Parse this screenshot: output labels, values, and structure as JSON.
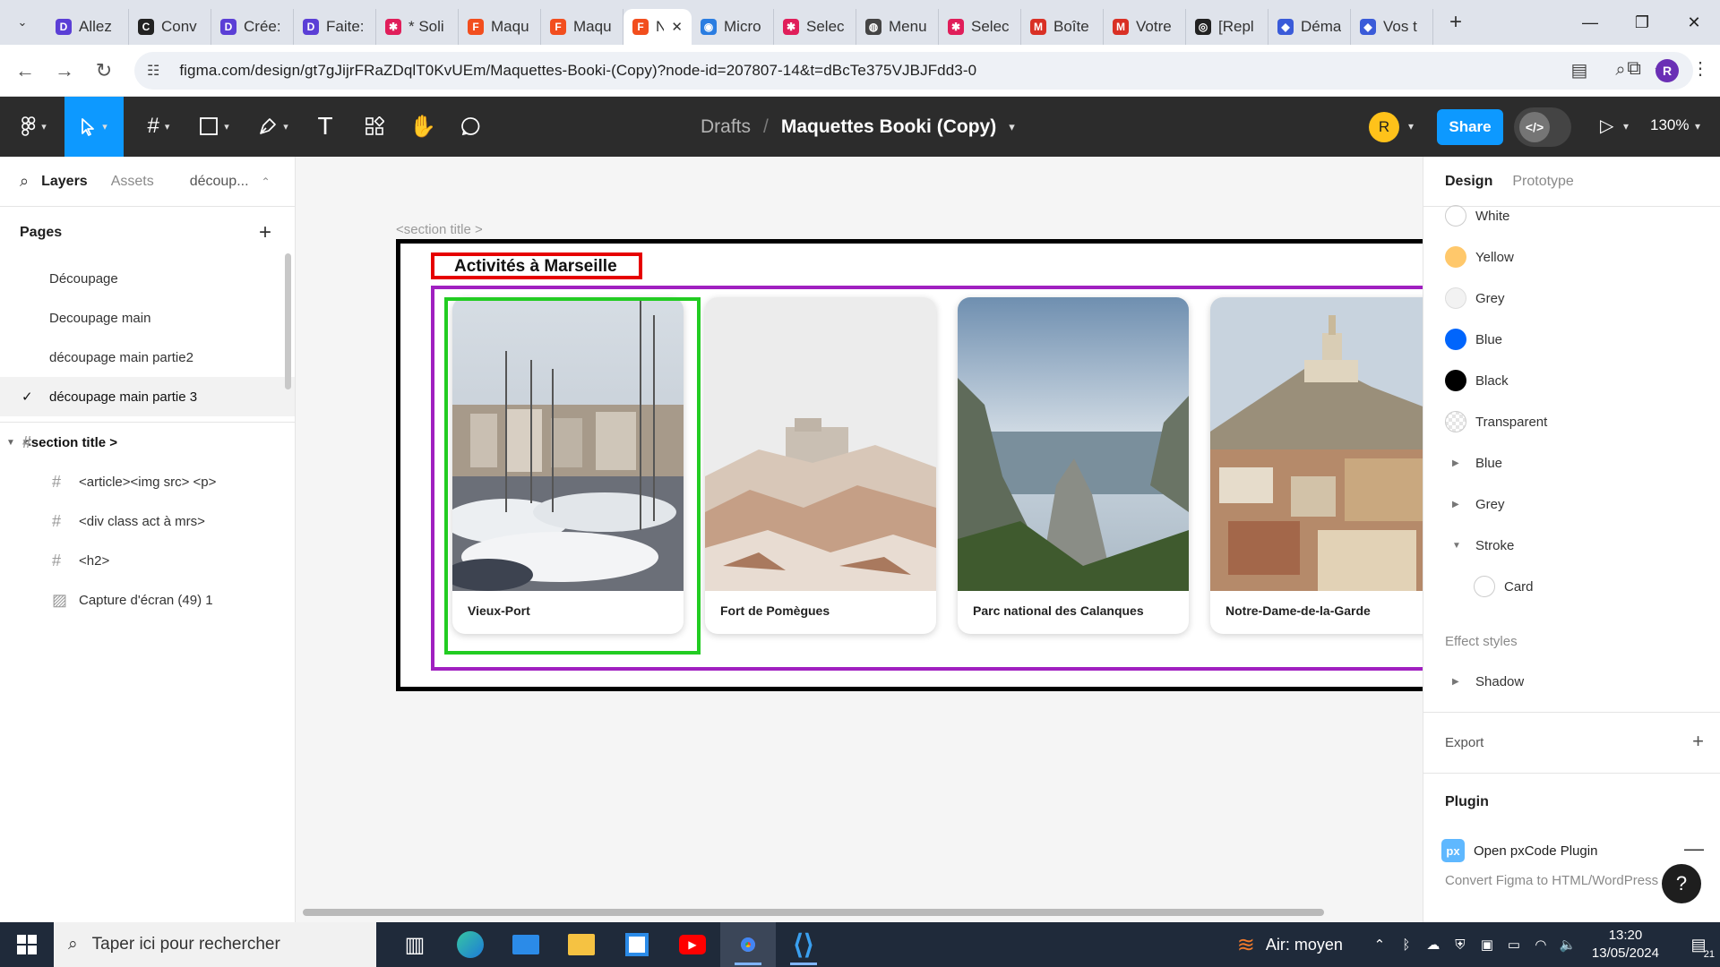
{
  "browser": {
    "tabs": [
      {
        "title": "Allez",
        "icon": "D",
        "color": "#5b3fd6"
      },
      {
        "title": "Conv",
        "icon": "C",
        "color": "#222222"
      },
      {
        "title": "Crée:",
        "icon": "D",
        "color": "#5b3fd6"
      },
      {
        "title": "Faite:",
        "icon": "D",
        "color": "#5b3fd6"
      },
      {
        "title": "* Soli",
        "icon": "✱",
        "color": "#e01e5a"
      },
      {
        "title": "Maqu",
        "icon": "F",
        "color": "#f24e1e"
      },
      {
        "title": "Maqu",
        "icon": "F",
        "color": "#f24e1e"
      },
      {
        "title": "N",
        "icon": "F",
        "color": "#f24e1e",
        "active": true
      },
      {
        "title": "Micro",
        "icon": "◉",
        "color": "#2a7de1"
      },
      {
        "title": "Selec",
        "icon": "✱",
        "color": "#e01e5a"
      },
      {
        "title": "Menu",
        "icon": "◍",
        "color": "#444444"
      },
      {
        "title": "Selec",
        "icon": "✱",
        "color": "#e01e5a"
      },
      {
        "title": "Boîte",
        "icon": "M",
        "color": "#d93025"
      },
      {
        "title": "Votre",
        "icon": "M",
        "color": "#d93025"
      },
      {
        "title": "[Repl",
        "icon": "◎",
        "color": "#222222"
      },
      {
        "title": "Déma",
        "icon": "◆",
        "color": "#3a5bd9"
      },
      {
        "title": "Vos t",
        "icon": "◆",
        "color": "#3a5bd9"
      }
    ],
    "url": "figma.com/design/gt7gJijrFRaZDqlT0KvUEm/Maquettes-Booki-(Copy)?node-id=207807-14&t=dBcTe375VJBJFdd3-0",
    "profile_initial": "R"
  },
  "figma": {
    "breadcrumb_drafts": "Drafts",
    "breadcrumb_sep": "/",
    "file_name": "Maquettes Booki (Copy)",
    "user_initial": "R",
    "share_label": "Share",
    "zoom_label": "130%",
    "left": {
      "tab_layers": "Layers",
      "tab_assets": "Assets",
      "current_page_short": "découp...",
      "pages_header": "Pages",
      "pages": [
        {
          "name": "Découpage"
        },
        {
          "name": "Decoupage main"
        },
        {
          "name": "découpage main partie2"
        },
        {
          "name": "découpage main partie 3"
        }
      ],
      "layers": [
        {
          "name": "<section title >",
          "type": "frame"
        },
        {
          "name": "<article><img src> <p>",
          "type": "frame"
        },
        {
          "name": "<div class act à mrs>",
          "type": "frame"
        },
        {
          "name": "<h2>",
          "type": "frame"
        },
        {
          "name": "Capture d'écran (49) 1",
          "type": "image"
        }
      ]
    },
    "canvas": {
      "section_label": "<section title >",
      "heading": "Activités à Marseille",
      "cards": [
        {
          "name": "Vieux-Port"
        },
        {
          "name": "Fort de Pomègues"
        },
        {
          "name": "Parc national des Calanques"
        },
        {
          "name": "Notre-Dame-de-la-Garde"
        }
      ],
      "colors": {
        "frame_border": "#000000",
        "h2_outline": "#e60000",
        "div_outline": "#a020c0",
        "article_outline": "#22cc22"
      }
    },
    "right": {
      "tab_design": "Design",
      "tab_prototype": "Prototype",
      "color_styles": [
        {
          "name": "White",
          "color": "#ffffff"
        },
        {
          "name": "Yellow",
          "color": "#ffc86b"
        },
        {
          "name": "Grey",
          "color": "#f2f2f2"
        },
        {
          "name": "Blue",
          "color": "#0065fc"
        },
        {
          "name": "Black",
          "color": "#000000"
        },
        {
          "name": "Transparent",
          "color": "transparent"
        }
      ],
      "groups": [
        {
          "name": "Blue"
        },
        {
          "name": "Grey"
        },
        {
          "name": "Stroke"
        }
      ],
      "stroke_child": "Card",
      "effect_styles_label": "Effect styles",
      "effect_shadow": "Shadow",
      "export_label": "Export",
      "plugin_label": "Plugin",
      "plugin_name": "Open pxCode Plugin",
      "plugin_icon_text": "px",
      "plugin_desc": "Convert Figma to HTML/WordPress",
      "help_label": "?"
    }
  },
  "taskbar": {
    "search_placeholder": "Taper ici pour rechercher",
    "weather": "Air: moyen",
    "time": "13:20",
    "date": "13/05/2024",
    "notifications": "21"
  }
}
